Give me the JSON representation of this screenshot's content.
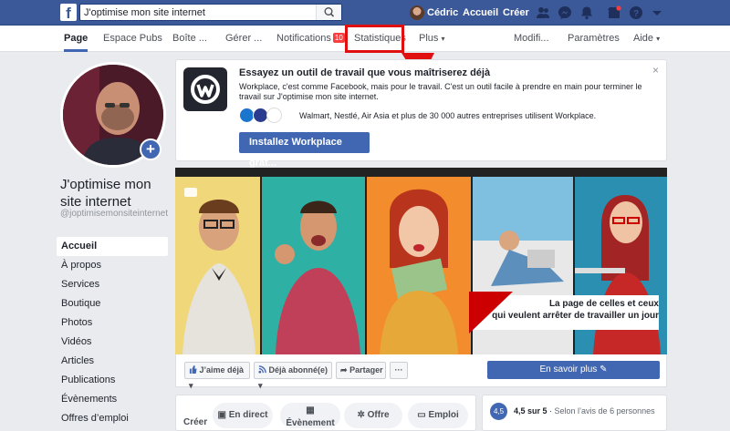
{
  "topbar": {
    "logo": "f",
    "search_value": "J'optimise mon site internet",
    "user_name": "Cédric",
    "home_label": "Accueil",
    "create_label": "Créer",
    "icons": [
      "friends-icon",
      "messenger-icon",
      "bell-icon",
      "marketplace-icon",
      "help-icon",
      "chevron-down-icon"
    ]
  },
  "nav": {
    "tabs": [
      "Page",
      "Espace Pubs",
      "Boîte ...",
      "Gérer ...",
      "Notifications",
      "Statistiques",
      "Plus",
      "Modifi...",
      "Paramètres",
      "Aide"
    ],
    "notifications_badge": "10",
    "more_caret": "▾",
    "help_caret": "▾"
  },
  "profile": {
    "name": "J'optimise mon site internet",
    "handle": "@joptimisemonsiteinternet",
    "plus": "+"
  },
  "sidebar": {
    "items": [
      "Accueil",
      "À propos",
      "Services",
      "Boutique",
      "Photos",
      "Vidéos",
      "Articles",
      "Publications",
      "Évènements",
      "Offres d’emploi"
    ]
  },
  "promo": {
    "title": "Essayez un outil de travail que vous maîtriserez déjà",
    "description": "Workplace, c'est comme Facebook, mais pour le travail. C'est un outil facile à prendre en main pour terminer le travail sur J'optimise mon site internet.",
    "companies": "Walmart, Nestlé, Air Asia et plus de 30 000 autres entreprises utilisent Workplace.",
    "install_label": "Installez Workplace grat...",
    "close": "×"
  },
  "cover": {
    "banner_line1": "La page de celles et ceux",
    "banner_line2": "qui veulent arrêter de travailler un jour"
  },
  "actions": {
    "like": "J’aime déjà",
    "follow": "Déjà abonné(e)",
    "share": "Partager",
    "more": "···",
    "learn_more": "En savoir plus"
  },
  "create": {
    "label": "Créer",
    "buttons": [
      "En direct",
      "Évènement",
      "Offre",
      "Emploi"
    ]
  },
  "rating": {
    "score": "4,5",
    "text": "4,5 sur 5",
    "detail": "Selon l’avis de 6 personnes"
  },
  "colors": {
    "brand": "#3b5998",
    "primary_button": "#4267b2",
    "highlight": "#e01010"
  }
}
